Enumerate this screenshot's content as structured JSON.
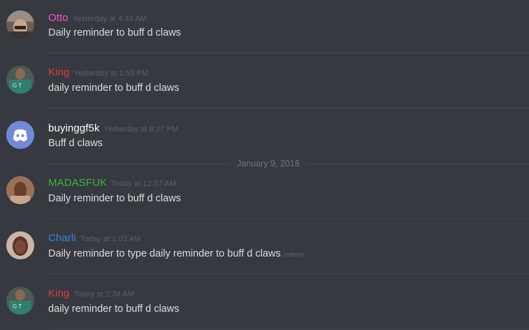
{
  "colors": {
    "background": "#36393f",
    "text": "#dcddde",
    "muted": "#5d6168",
    "pink": "#ff4fd8",
    "red": "#e83a3a",
    "white": "#ffffff",
    "green": "#35b83a",
    "blue": "#3a86e8",
    "discord_blurple": "#7289da"
  },
  "date_separator": "January 9, 2018",
  "messages": [
    {
      "avatar": "user-photo-avatar",
      "username": "Otto",
      "username_color": "#ff4fd8",
      "timestamp": "Yesterday at 4:39 AM",
      "text": "Daily reminder to buff d claws",
      "edited": ""
    },
    {
      "avatar": "user-photo-avatar",
      "username": "King",
      "username_color": "#e83a3a",
      "timestamp": "Yesterday at 1:53 PM",
      "text": "daily reminder to buff d claws",
      "edited": ""
    },
    {
      "avatar": "discord-logo-avatar",
      "username": "buyinggf5k",
      "username_color": "#ffffff",
      "timestamp": "Yesterday at 8:27 PM",
      "text": "Buff d claws",
      "edited": ""
    },
    {
      "avatar": "user-photo-avatar",
      "username": "MADASFUK",
      "username_color": "#35b83a",
      "timestamp": "Today at 12:57 AM",
      "text": "Daily reminder to buff d claws",
      "edited": ""
    },
    {
      "avatar": "user-photo-avatar",
      "username": "Charli",
      "username_color": "#3a86e8",
      "timestamp": "Today at 1:03 AM",
      "text": "Daily reminder to type daily reminder to buff d claws",
      "edited": "(edited)"
    },
    {
      "avatar": "user-photo-avatar",
      "username": "King",
      "username_color": "#e83a3a",
      "timestamp": "Today at 2:34 AM",
      "text": "daily reminder to buff d claws",
      "edited": ""
    }
  ]
}
